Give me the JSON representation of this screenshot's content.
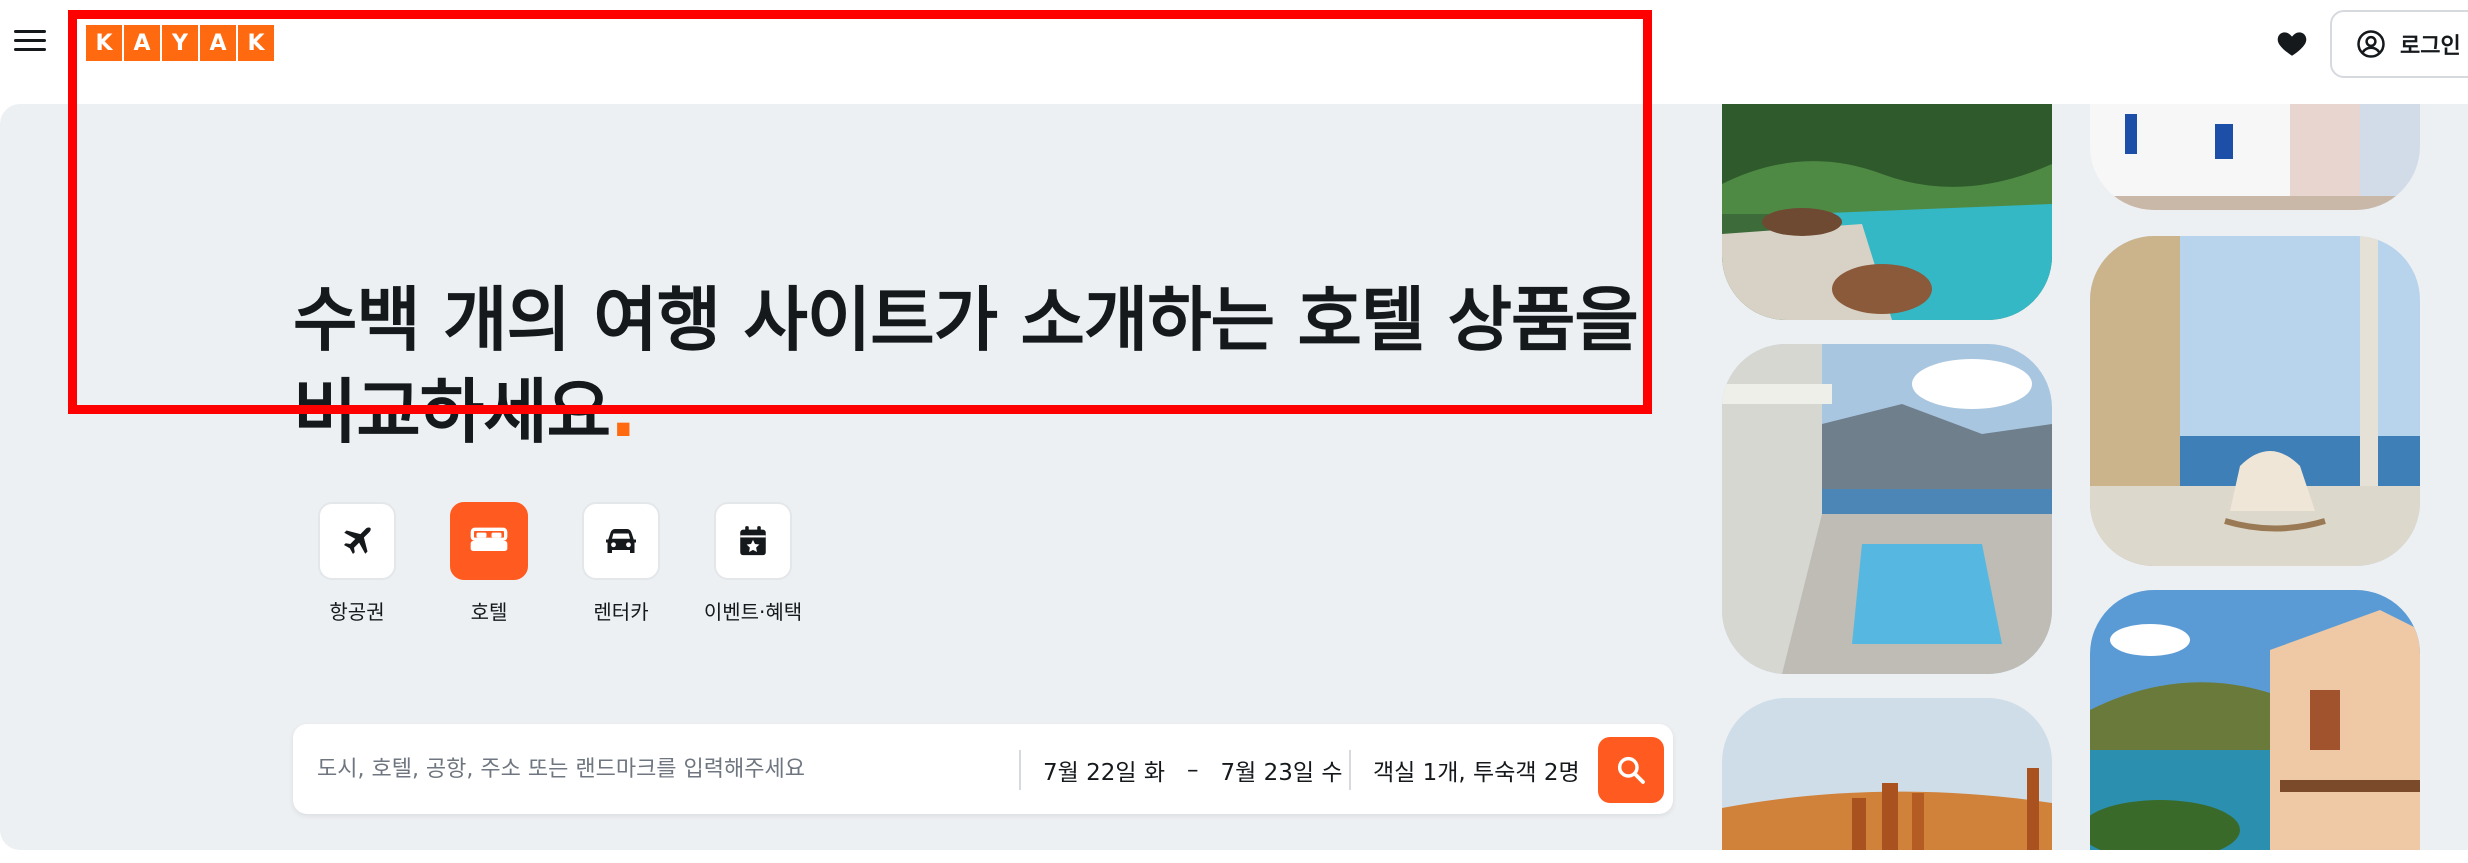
{
  "header": {
    "logo_letters": [
      "K",
      "A",
      "Y",
      "A",
      "K"
    ],
    "login_label": "로그인",
    "menu_icon": "hamburger-icon",
    "favorites_icon": "heart-icon",
    "account_icon": "user-circle-icon"
  },
  "hero": {
    "headline": "수백 개의 여행 사이트가 소개하는 호텔 상품을 비교하세요",
    "headline_dot": "."
  },
  "verticals": [
    {
      "label": "항공권",
      "icon": "airplane-icon",
      "active": false
    },
    {
      "label": "호텔",
      "icon": "bed-icon",
      "active": true
    },
    {
      "label": "렌터카",
      "icon": "car-icon",
      "active": false
    },
    {
      "label": "이벤트·혜택",
      "icon": "calendar-star-icon",
      "active": false
    }
  ],
  "search": {
    "destination_placeholder": "도시, 호텔, 공항, 주소 또는 랜드마크를 입력해주세요",
    "checkin": "7월 22일 화",
    "dash": "–",
    "checkout": "7월 23일 수",
    "guests": "객실 1개, 투숙객 2명",
    "search_icon": "search-icon"
  },
  "colors": {
    "brand": "#ff690f",
    "accent": "#ff5a1f",
    "hero_bg": "#edf0f3",
    "annotation_box": "#ff0000"
  }
}
